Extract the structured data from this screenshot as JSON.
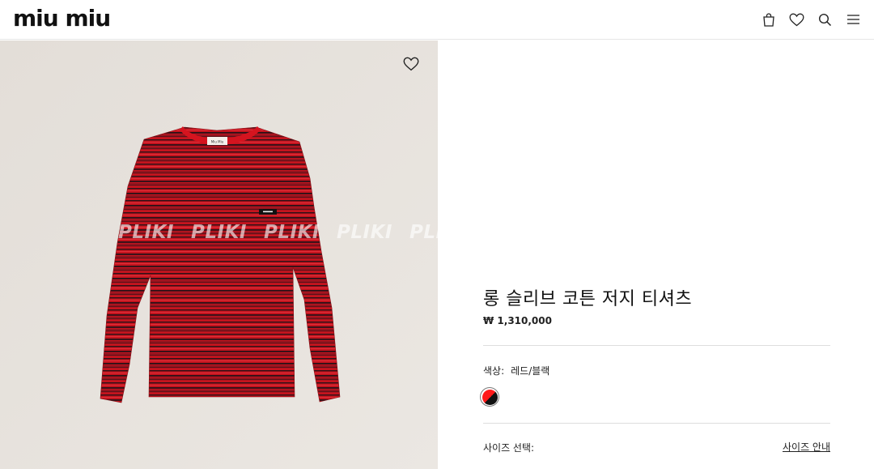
{
  "header": {
    "logo_text": "miu miu",
    "icons": [
      "bag-icon",
      "heart-icon",
      "search-icon",
      "menu-icon"
    ]
  },
  "media": {
    "watermark": [
      "PLIKI",
      "PLIKI",
      "PLIKI",
      "PLIKI",
      "PLIKI"
    ],
    "wishlist_icon": "heart-icon",
    "garment_label_text": "Miu Miu"
  },
  "product": {
    "title": "롱 슬리브 코튼 저지 티셔츠",
    "price": "₩ 1,310,000",
    "color_label": "색상",
    "color_separator": ":",
    "color_value": "레드/블랙",
    "swatch_colors": [
      "#ff1a1a",
      "#111111"
    ],
    "size_label": "사이즈 선택:",
    "size_guide_link": "사이즈 안내"
  },
  "colors": {
    "media_background": "#e6e2dd",
    "shirt_red": "#c4141e",
    "shirt_stripe_dark": "#2a1218"
  }
}
